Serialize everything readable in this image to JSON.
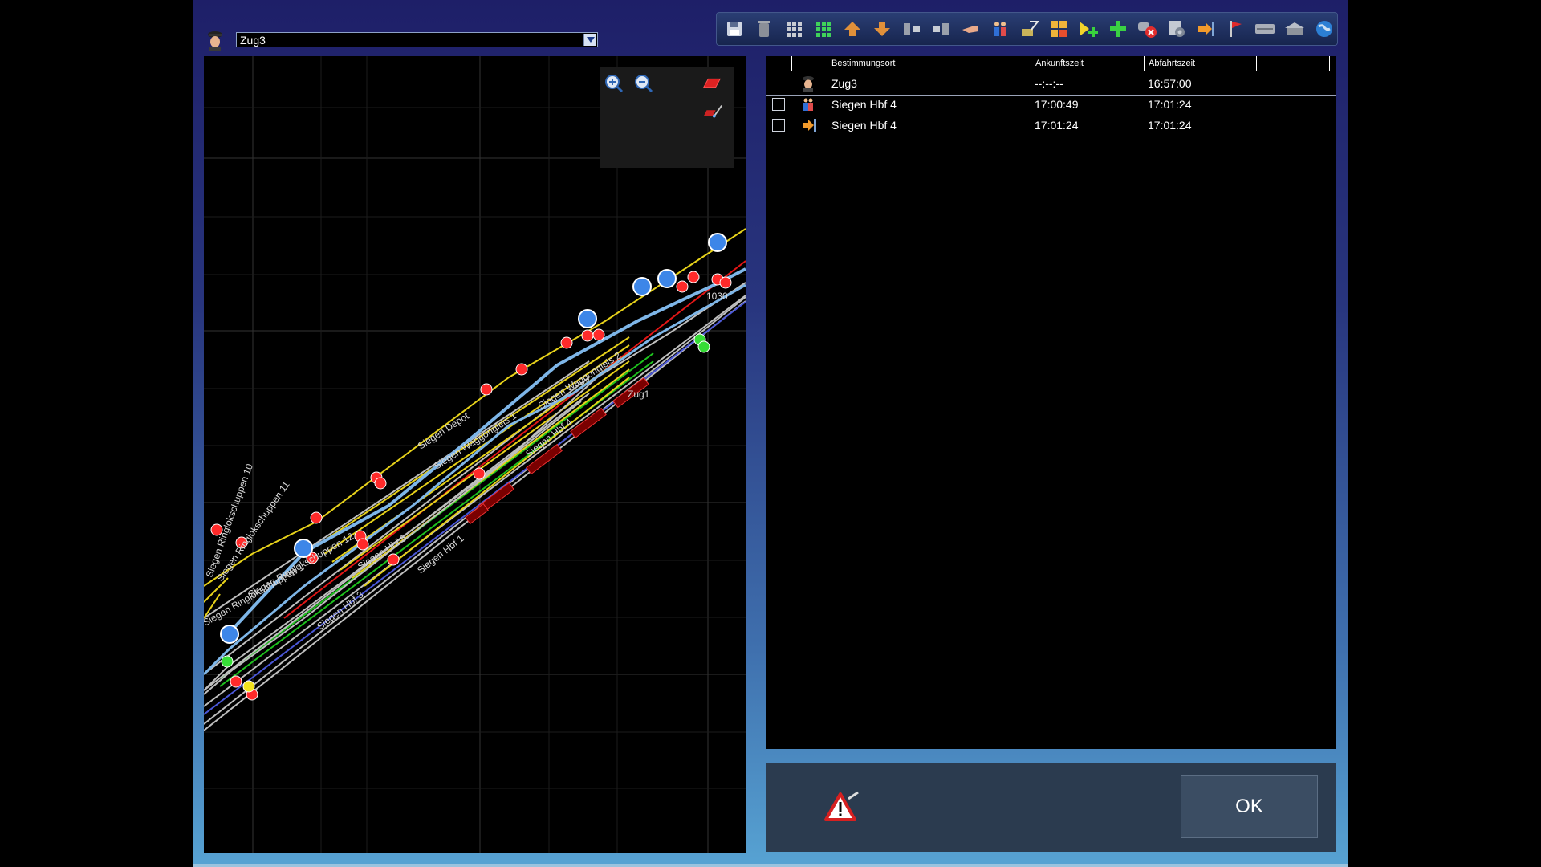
{
  "train_selector": {
    "value": "Zug3",
    "icon": "conductor-icon"
  },
  "toolbar": {
    "buttons": [
      {
        "icon": "save-icon"
      },
      {
        "icon": "trash-icon"
      },
      {
        "icon": "grid-gray-icon"
      },
      {
        "icon": "grid-green-icon"
      },
      {
        "icon": "arrow-up-icon"
      },
      {
        "icon": "arrow-down-icon"
      },
      {
        "icon": "merge-left-icon"
      },
      {
        "icon": "merge-right-icon"
      },
      {
        "icon": "pointer-hand-icon"
      },
      {
        "icon": "passengers-icon"
      },
      {
        "icon": "cargo-load-icon"
      },
      {
        "icon": "switch-grid-icon"
      },
      {
        "icon": "add-waypoint-icon"
      },
      {
        "icon": "add-plus-icon"
      },
      {
        "icon": "remove-route-icon"
      },
      {
        "icon": "settings-icon"
      },
      {
        "icon": "exit-icon"
      },
      {
        "icon": "flag-icon"
      },
      {
        "icon": "platform-icon"
      },
      {
        "icon": "station-icon"
      },
      {
        "icon": "globe-icon"
      }
    ]
  },
  "map": {
    "labels": {
      "ringlok10": "Siegen Ringlokschuppen 10",
      "ringlok11": "Siegen Ringlokschuppen 11",
      "ringlok12": "Siegen Ringlokschuppen 12",
      "ringlok_a": "Siegen Ringlokschuppen 1",
      "hbf5": "Siegen Hbf 5",
      "hbf3": "Siegen Hbf 3",
      "hbf1": "Siegen Hbf 1",
      "hbf4": "Siegen Hbf 4",
      "depot": "Siegen Depot",
      "wagon1": "Siegen Waggongleis 1",
      "wagon2": "Siegen Waggongleis 2",
      "zug1": "Zug1",
      "block": "1030"
    },
    "controls": [
      "zoom-in-icon",
      "zoom-out-icon",
      "eraser-icon",
      "edit-track-icon"
    ]
  },
  "timetable": {
    "columns": [
      "Bestimmungsort",
      "Ankunftszeit",
      "Abfahrtszeit"
    ],
    "rows": [
      {
        "icon": "conductor-icon",
        "destination": "Zug3",
        "arrival": "--:--:--",
        "departure": "16:57:00",
        "checkbox": false
      },
      {
        "icon": "passengers-icon",
        "destination": "Siegen Hbf 4",
        "arrival": "17:00:49",
        "departure": "17:01:24",
        "checkbox": true
      },
      {
        "icon": "exit-arrow-icon",
        "destination": "Siegen Hbf 4",
        "arrival": "17:01:24",
        "departure": "17:01:24",
        "checkbox": true
      }
    ]
  },
  "footer": {
    "ok_label": "OK",
    "warning_icon": "warning-icon"
  },
  "colors": {
    "track_yellow": "#e7d21a",
    "track_green": "#1ec21e",
    "track_blue": "#4a57d8",
    "track_gray": "#bfbfbf",
    "track_red": "#e21616",
    "route_blue": "#7eb6e8",
    "signal_red": "#ff2a2a",
    "signal_green": "#36dc36",
    "node_blue": "#3d86e8"
  }
}
